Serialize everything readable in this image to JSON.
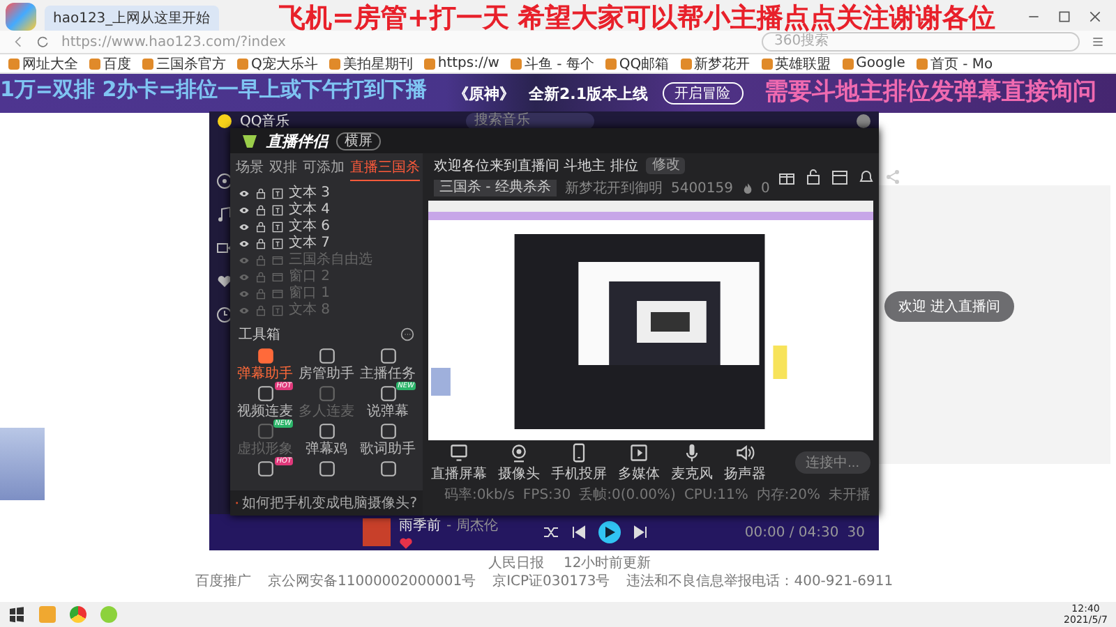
{
  "browser": {
    "tab_title": "hao123_上网从这里开始",
    "address": "https://www.hao123.com/?index",
    "search_placeholder": "360搜索",
    "bookmarks": [
      "网址大全",
      "百度",
      "三国杀官方",
      "Q宠大乐斗",
      "美拍星期刊",
      "https://w",
      "斗鱼 - 每个",
      "QQ邮箱",
      "新梦花开",
      "英雄联盟",
      "Google",
      "首页 - Mo"
    ],
    "banner": {
      "game": "《原神》",
      "headline": "全新2.1版本上线",
      "button": "开启冒险"
    },
    "welcome_popup": "欢迎 进入直播间",
    "news": [
      "人民日报",
      "12小时前更新"
    ],
    "footer": [
      "百度推广",
      "京公网安备11000002000001号",
      "京ICP证030173号",
      "违法和不良信息举报电话：400-921-6911"
    ]
  },
  "overlays": [
    {
      "text": "飞机=房管+打一天  希望大家可以帮小主播点点关注谢谢各位",
      "color": "#e8202a"
    },
    {
      "text": "1万=双排 2办卡=排位一早上或下午打到下播",
      "color": "#7fc4f2"
    },
    {
      "text": "需要斗地主排位发弹幕直接询问",
      "color": "#f06ab0"
    }
  ],
  "music": {
    "title": "QQ音乐",
    "search_placeholder": "搜索音乐",
    "player": {
      "song": "雨季前",
      "artist": "- 周杰伦",
      "liked": true,
      "playing": false,
      "time": "00:00 / 04:30",
      "count": "30"
    }
  },
  "app": {
    "title": "直播伴侣",
    "mode_button": "横屏",
    "scene_tabs": [
      {
        "label": "场景",
        "selected": false
      },
      {
        "label": "双排",
        "selected": false
      },
      {
        "label": "可添加",
        "selected": false
      },
      {
        "label": "直播三国杀",
        "selected": true
      }
    ],
    "sources": [
      {
        "label": "文本 3",
        "kind": "text",
        "visible": true
      },
      {
        "label": "文本 4",
        "kind": "text",
        "visible": true
      },
      {
        "label": "文本 6",
        "kind": "text",
        "visible": true
      },
      {
        "label": "文本 7",
        "kind": "text",
        "visible": true
      },
      {
        "label": "三国杀自由选",
        "kind": "window",
        "visible": false
      },
      {
        "label": "窗口 2",
        "kind": "window",
        "visible": false
      },
      {
        "label": "窗口 1",
        "kind": "window",
        "visible": false
      },
      {
        "label": "文本 8",
        "kind": "text",
        "visible": false
      }
    ],
    "toolbox_title": "工具箱",
    "tools": [
      {
        "label": "弹幕助手",
        "selected": true,
        "enabled": true
      },
      {
        "label": "房管助手",
        "selected": false,
        "enabled": true
      },
      {
        "label": "主播任务",
        "selected": false,
        "enabled": true
      },
      {
        "label": "视频连麦",
        "selected": false,
        "enabled": true,
        "badge": "HOT"
      },
      {
        "label": "多人连麦",
        "selected": false,
        "enabled": false
      },
      {
        "label": "说弹幕",
        "selected": false,
        "enabled": true,
        "badge": "NEW"
      },
      {
        "label": "虚拟形象",
        "selected": false,
        "enabled": false,
        "badge": "NEW"
      },
      {
        "label": "弹幕鸡",
        "selected": false,
        "enabled": true
      },
      {
        "label": "歌词助手",
        "selected": false,
        "enabled": true
      },
      {
        "selected": false,
        "enabled": true,
        "badge": "HOT"
      },
      {
        "selected": false,
        "enabled": true
      },
      {
        "selected": false,
        "enabled": true
      }
    ],
    "hint": "如何把手机变成电脑摄像头?",
    "room_title": "欢迎各位来到直播间 斗地主 排位",
    "edit_button": "修改",
    "category": "三国杀 - 经典杀杀",
    "nickname": "新梦花开到御明",
    "room_id": "5400159",
    "heat": "0",
    "inputs": [
      {
        "label": "直播屏幕",
        "kind": "screen"
      },
      {
        "label": "摄像头",
        "kind": "camera"
      },
      {
        "label": "手机投屏",
        "kind": "phone"
      },
      {
        "label": "多媒体",
        "kind": "media"
      },
      {
        "label": "麦克风",
        "kind": "mic"
      },
      {
        "label": "扬声器",
        "kind": "speaker"
      }
    ],
    "start_button": "连接中...",
    "status": [
      "码率:0kb/s",
      "FPS:30",
      "丢帧:0(0.00%)",
      "CPU:11%",
      "内存:20%",
      "未开播"
    ]
  },
  "taskbar": {
    "time": "12:40",
    "date": "2021/5/7"
  }
}
